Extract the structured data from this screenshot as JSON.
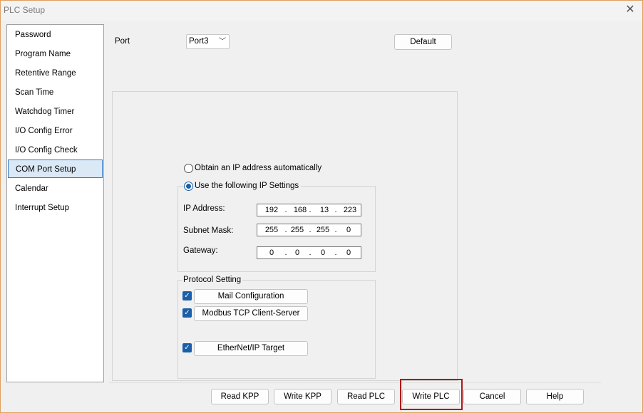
{
  "window": {
    "title": "PLC Setup",
    "close_icon": "close-icon"
  },
  "sidebar": {
    "items": [
      {
        "label": "Password"
      },
      {
        "label": "Program Name"
      },
      {
        "label": "Retentive Range"
      },
      {
        "label": "Scan Time"
      },
      {
        "label": "Watchdog Timer"
      },
      {
        "label": "I/O Config Error"
      },
      {
        "label": "I/O Config Check"
      },
      {
        "label": "COM Port Setup",
        "selected": true
      },
      {
        "label": "Calendar"
      },
      {
        "label": "Interrupt Setup"
      }
    ]
  },
  "port": {
    "label": "Port",
    "value": "Port3",
    "default_button": "Default"
  },
  "ip": {
    "obtain_auto_label": "Obtain an IP address automatically",
    "use_following_label": "Use the following IP Settings",
    "ip_address_label": "IP Address:",
    "subnet_mask_label": "Subnet Mask:",
    "gateway_label": "Gateway:",
    "ip_address": [
      "192",
      "168",
      "13",
      "223"
    ],
    "subnet_mask": [
      "255",
      "255",
      "255",
      "0"
    ],
    "gateway": [
      "0",
      "0",
      "0",
      "0"
    ],
    "dot": "."
  },
  "protocol": {
    "title": "Protocol Setting",
    "mail_configuration": "Mail Configuration",
    "modbus": "Modbus TCP Client-Server",
    "ethernet_ip": "EtherNet/IP Target"
  },
  "buttons": {
    "read_kpp": "Read KPP",
    "write_kpp": "Write KPP",
    "read_plc": "Read PLC",
    "write_plc": "Write PLC",
    "cancel": "Cancel",
    "help": "Help"
  },
  "colors": {
    "accent": "#1a5fa8",
    "highlight": "#b01818",
    "selection_bg": "#dbe8f5"
  }
}
